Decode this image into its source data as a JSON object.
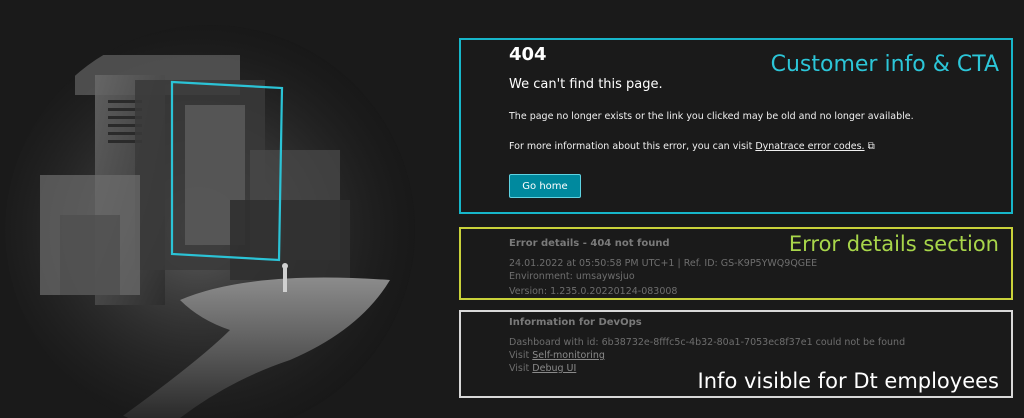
{
  "annotations": {
    "customer": "Customer info & CTA",
    "error_details": "Error details section",
    "devops": "Info visible for Dt employees"
  },
  "error_page": {
    "code": "404",
    "heading": "We can't find this page.",
    "message": "The page no longer exists or the link you clicked may be old and no longer available.",
    "more_info_prefix": "For more information about this error, you can visit",
    "more_info_link": "Dynatrace error codes.",
    "go_home_label": "Go home"
  },
  "error_details": {
    "title": "Error details - 404 not found",
    "timestamp": "24.01.2022 at 05:50:58 PM UTC+1 | Ref. ID: GS-K9P5YWQ9QGEE",
    "environment": "Environment: umsaywsjuo",
    "version": "Version: 1.235.0.20220124-083008"
  },
  "devops": {
    "title": "Information for DevOps",
    "dashboard_msg": "Dashboard with id: 6b38732e-8fffc5c-4b32-80a1-7053ec8f37e1 could not be found",
    "visit_prefix": "Visit",
    "self_monitoring": "Self-monitoring",
    "debug_ui": "Debug UI"
  },
  "colors": {
    "background": "#1a1a1a",
    "cyan": "#17b6c9",
    "yellow_green": "#c9d23a",
    "white_border": "#d8d8d8",
    "button": "#00899e"
  }
}
